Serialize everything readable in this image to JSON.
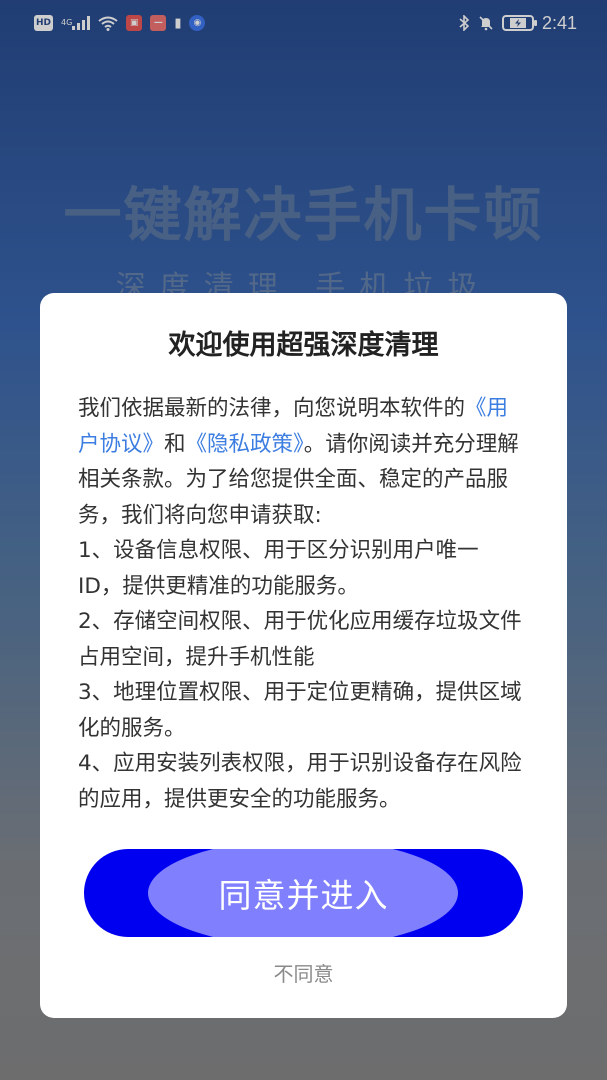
{
  "status_bar": {
    "left": {
      "hd": "HD",
      "network": "4G",
      "red_app_label": "▣",
      "app_label": "—",
      "battery_small": "▮",
      "blue_app": "◉"
    },
    "right": {
      "time": "2:41"
    }
  },
  "background": {
    "title": "一键解决手机卡顿",
    "subtitle": "深度清理  手机垃圾"
  },
  "dialog": {
    "title": "欢迎使用超强深度清理",
    "body": {
      "p1_before": "我们依据最新的法律，向您说明本软件的",
      "link_user_agreement": "《用户协议》",
      "and": "和",
      "link_privacy_policy": "《隐私政策》",
      "p1_after": "。请你阅读并充分理解相关条款。为了给您提供全面、稳定的产品服务，我们将向您申请获取:",
      "item1": "1、设备信息权限、用于区分识别用户唯一ID，提供更精准的功能服务。",
      "item2": "2、存储空间权限、用于优化应用缓存垃圾文件占用空间，提升手机性能",
      "item3": "3、地理位置权限、用于定位更精确，提供区域化的服务。",
      "item4": "4、应用安装列表权限，用于识别设备存在风险的应用，提供更安全的功能服务。"
    },
    "agree_label": "同意并进入",
    "disagree_label": "不同意"
  },
  "colors": {
    "primary_button": "#0000f0",
    "button_highlight": "#8080ff",
    "link": "#3b7de0"
  }
}
